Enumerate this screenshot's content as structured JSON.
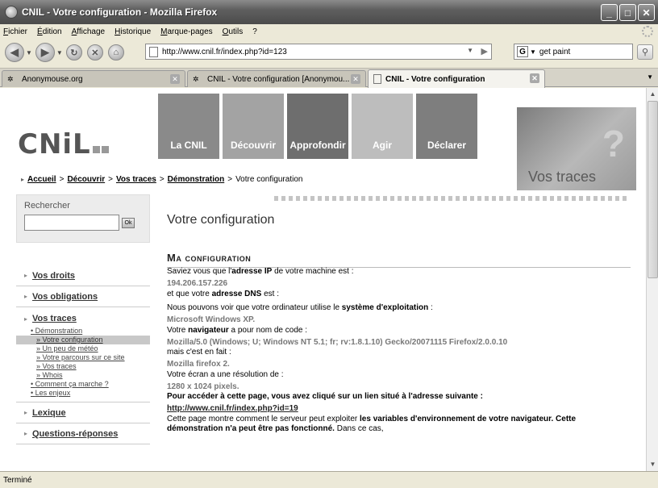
{
  "window": {
    "title": "CNIL - Votre configuration - Mozilla Firefox"
  },
  "menu": [
    "Fichier",
    "Édition",
    "Affichage",
    "Historique",
    "Marque-pages",
    "Outils",
    "?"
  ],
  "toolbar": {
    "url": "http://www.cnil.fr/index.php?id=123",
    "search_value": "get paint"
  },
  "tabs": [
    {
      "label": "Anonymouse.org",
      "active": false
    },
    {
      "label": "CNIL - Votre configuration [Anonymou...",
      "active": false
    },
    {
      "label": "CNIL - Votre configuration",
      "active": true
    }
  ],
  "site": {
    "logo": "CNiL",
    "nav": [
      {
        "label": "La CNIL",
        "color": "#8a8a8a"
      },
      {
        "label": "Découvrir",
        "color": "#a3a3a3"
      },
      {
        "label": "Approfondir",
        "color": "#6e6e6e"
      },
      {
        "label": "Agir",
        "color": "#bdbdbd"
      },
      {
        "label": "Déclarer",
        "color": "#7e7e7e"
      }
    ],
    "banner_text": "Vos traces",
    "breadcrumb": [
      "Accueil",
      "Découvrir",
      "Vos traces",
      "Démonstration",
      "Votre configuration"
    ],
    "search": {
      "label": "Rechercher",
      "button": "Ok"
    },
    "left_nav": {
      "items": [
        "Vos droits",
        "Vos obligations",
        "Vos traces",
        "Lexique",
        "Questions-réponses"
      ],
      "sub": {
        "demo": "Démonstration",
        "current": "Votre configuration",
        "meteo": "Un peu de météo",
        "parcours": "Votre parcours sur ce site",
        "traces": "Vos traces",
        "whois": "Whois",
        "comment": "Comment ça marche ?",
        "enjeux": "Les enjeux"
      }
    }
  },
  "page": {
    "title": "Votre configuration",
    "section": "Ma configuration",
    "l1a": "Saviez vous que l'",
    "l1b": "adresse IP",
    "l1c": " de votre machine est :",
    "ip": "194.206.157.226",
    "l2a": "et que votre ",
    "l2b": "adresse DNS",
    "l2c": " est :",
    "l3a": "Nous pouvons voir que votre ordinateur utilise le ",
    "l3b": "système d'exploitation",
    "l3c": " :",
    "os": "Microsoft Windows XP.",
    "l4a": "Votre ",
    "l4b": "navigateur",
    "l4c": " a pour nom de code :",
    "ua": "Mozilla/5.0 (Windows; U; Windows NT 5.1; fr; rv:1.8.1.10) Gecko/20071115 Firefox/2.0.0.10",
    "l5": "mais c'est en fait :",
    "browser": "Mozilla firefox 2.",
    "l6": "Votre écran a une résolution de :",
    "resolution": "1280 x 1024 pixels.",
    "l7": "Pour accéder à cette page, vous avez cliqué sur un lien situé à l'adresse suivante :",
    "referer": "http://www.cnil.fr/index.php?id=19",
    "l8a": "Cette page montre comment le serveur peut exploiter ",
    "l8b": "les variables d'environnement de votre navigateur. Cette",
    "l9a": "démonstration n'a peut être pas fonctionné.",
    "l9b": " Dans ce cas,"
  },
  "status": "Terminé"
}
